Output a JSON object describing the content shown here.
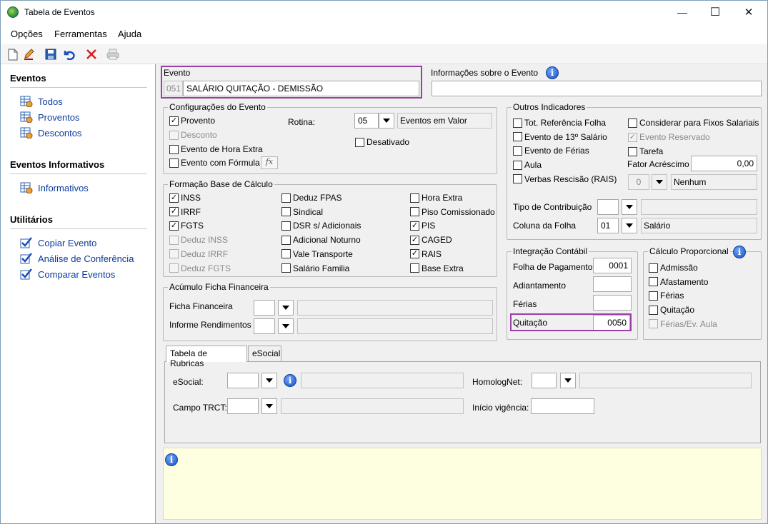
{
  "window": {
    "title": "Tabela de Eventos",
    "min": "—",
    "max": "☐",
    "close": "✕"
  },
  "menu": [
    {
      "label": "Opções"
    },
    {
      "label": "Ferramentas"
    },
    {
      "label": "Ajuda"
    }
  ],
  "toolbar": [
    "new-document-icon",
    "edit-icon",
    "save-icon",
    "undo-icon",
    "delete-icon",
    "print-icon"
  ],
  "sidebar": {
    "sections": [
      {
        "title": "Eventos",
        "items": [
          "Todos",
          "Proventos",
          "Descontos"
        ]
      },
      {
        "title": "Eventos Informativos",
        "items": [
          "Informativos"
        ]
      },
      {
        "title": "Utilitários",
        "items": [
          "Copiar Evento",
          "Análise de Conferência",
          "Comparar Eventos"
        ]
      }
    ]
  },
  "evento": {
    "label": "Evento",
    "code": "051",
    "name": "SALÁRIO QUITAÇÃO - DEMISSÃO",
    "info_label": "Informações sobre o Evento",
    "info_value": ""
  },
  "config": {
    "title": "Configurações do Evento",
    "provento": "Provento",
    "desconto": "Desconto",
    "hora_extra": "Evento de Hora Extra",
    "formula": "Evento com Fórmula",
    "rotina_label": "Rotina:",
    "rotina_value": "05",
    "rotina_desc": "Eventos em Valor",
    "desativado": "Desativado",
    "fx": "fx"
  },
  "base": {
    "title": "Formação Base de Cálculo",
    "col1": [
      {
        "label": "INSS",
        "checked": true,
        "disabled": false
      },
      {
        "label": "IRRF",
        "checked": true,
        "disabled": false
      },
      {
        "label": "FGTS",
        "checked": true,
        "disabled": false
      },
      {
        "label": "Deduz INSS",
        "checked": false,
        "disabled": true
      },
      {
        "label": "Deduz IRRF",
        "checked": false,
        "disabled": true
      },
      {
        "label": "Deduz FGTS",
        "checked": false,
        "disabled": true
      }
    ],
    "col2": [
      {
        "label": "Deduz FPAS",
        "checked": false,
        "disabled": false
      },
      {
        "label": "Sindical",
        "checked": false,
        "disabled": false
      },
      {
        "label": "DSR s/ Adicionais",
        "checked": false,
        "disabled": false
      },
      {
        "label": "Adicional Noturno",
        "checked": false,
        "disabled": false
      },
      {
        "label": "Vale Transporte",
        "checked": false,
        "disabled": false
      },
      {
        "label": "Salário Familia",
        "checked": false,
        "disabled": false
      }
    ],
    "col3": [
      {
        "label": "Hora Extra",
        "checked": false,
        "disabled": false
      },
      {
        "label": "Piso Comissionado",
        "checked": false,
        "disabled": false
      },
      {
        "label": "PIS",
        "checked": true,
        "disabled": false
      },
      {
        "label": "CAGED",
        "checked": true,
        "disabled": false
      },
      {
        "label": "RAIS",
        "checked": true,
        "disabled": false
      },
      {
        "label": "Base Extra",
        "checked": false,
        "disabled": false
      }
    ]
  },
  "acumulo": {
    "title": "Acúmulo Ficha Financeira",
    "ficha": "Ficha Financeira",
    "informe": "Informe Rendimentos"
  },
  "outros": {
    "title": "Outros Indicadores",
    "left": [
      {
        "label": "Tot. Referência Folha",
        "checked": false
      },
      {
        "label": "Evento de 13º Salário",
        "checked": false
      },
      {
        "label": "Evento de Férias",
        "checked": false
      },
      {
        "label": "Aula",
        "checked": false
      },
      {
        "label": "Verbas Rescisão (RAIS)",
        "checked": false
      }
    ],
    "fixos": "Considerar para Fixos Salariais",
    "reservado": "Evento Reservado",
    "tarefa": "Tarefa",
    "fator_label": "Fator Acréscimo",
    "fator_value": "0,00",
    "rais_code": "0",
    "rais_desc": "Nenhum",
    "tipo_label": "Tipo de Contribuição",
    "coluna_label": "Coluna da Folha",
    "coluna_value": "01",
    "coluna_desc": "Salário"
  },
  "integracao": {
    "title": "Integração Contábil",
    "folha": "Folha de Pagamento",
    "folha_value": "0001",
    "adiantamento": "Adiantamento",
    "ferias": "Férias",
    "quitacao": "Quitação",
    "quitacao_value": "0050"
  },
  "proporcional": {
    "title": "Cálculo Proporcional",
    "items": [
      {
        "label": "Admissão",
        "disabled": false
      },
      {
        "label": "Afastamento",
        "disabled": false
      },
      {
        "label": "Férias",
        "disabled": false
      },
      {
        "label": "Quitação",
        "disabled": false
      },
      {
        "label": "Férias/Ev. Aula",
        "disabled": true
      }
    ]
  },
  "tabs": {
    "rubricas": "Tabela de Rubricas",
    "esocial": "eSocial"
  },
  "rubricas": {
    "esocial": "eSocial:",
    "homolog": "HomologNet:",
    "trct": "Campo TRCT:",
    "vigencia": "Início vigência:"
  },
  "colors": {
    "highlight": "#9b3fa8",
    "link": "#0b3c9d",
    "infobar": "#fefee0"
  }
}
